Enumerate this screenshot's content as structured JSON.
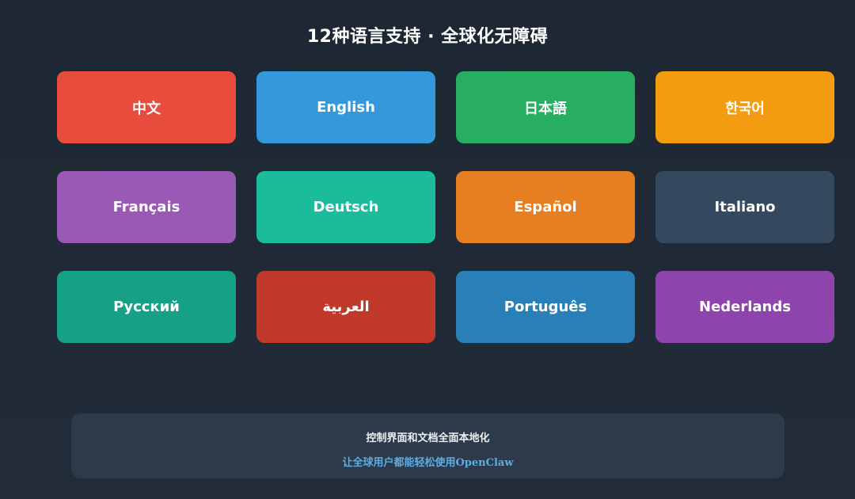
{
  "title": "12种语言支持 · 全球化无障碍",
  "languages": [
    {
      "label": "中文",
      "color": "#e74c3c"
    },
    {
      "label": "English",
      "color": "#3498db"
    },
    {
      "label": "日本語",
      "color": "#27ae60"
    },
    {
      "label": "한국어",
      "color": "#f39c12"
    },
    {
      "label": "Français",
      "color": "#9b59b6"
    },
    {
      "label": "Deutsch",
      "color": "#1abc9c"
    },
    {
      "label": "Español",
      "color": "#e67e22"
    },
    {
      "label": "Italiano",
      "color": "#34495e"
    },
    {
      "label": "Русский",
      "color": "#16a085"
    },
    {
      "label": "العربية",
      "color": "#c0392b"
    },
    {
      "label": "Português",
      "color": "#2980b9"
    },
    {
      "label": "Nederlands",
      "color": "#8e44ad"
    }
  ],
  "footer": {
    "line1": "控制界面和文档全面本地化",
    "line2": "让全球用户都能轻松使用OpenClaw"
  }
}
